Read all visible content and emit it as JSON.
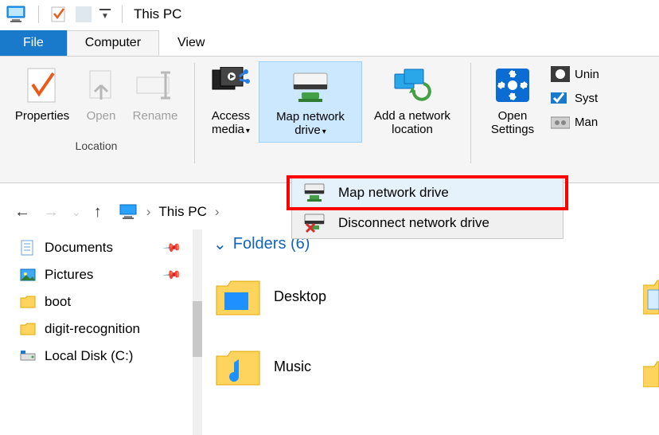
{
  "title": "This PC",
  "tabs": [
    "File",
    "Computer",
    "View"
  ],
  "ribbon": {
    "location": {
      "group_label": "Location",
      "properties": "Properties",
      "open": "Open",
      "rename": "Rename"
    },
    "network": {
      "access_media_l1": "Access",
      "access_media_l2": "media",
      "map_drive_l1": "Map network",
      "map_drive_l2": "drive",
      "add_loc_l1": "Add a network",
      "add_loc_l2": "location"
    },
    "system": {
      "open_settings_l1": "Open",
      "open_settings_l2": "Settings",
      "items": [
        "Unin",
        "Syst",
        "Man"
      ]
    }
  },
  "dropdown": {
    "items": [
      "Map network drive",
      "Disconnect network drive"
    ]
  },
  "breadcrumb": [
    "This PC"
  ],
  "sidebar": [
    {
      "label": "Documents",
      "pinned": true
    },
    {
      "label": "Pictures",
      "pinned": true
    },
    {
      "label": "boot",
      "pinned": false
    },
    {
      "label": "digit-recognition",
      "pinned": false
    },
    {
      "label": "Local Disk (C:)",
      "pinned": false
    }
  ],
  "main": {
    "folders_header": "Folders (6)",
    "folders": [
      "Desktop",
      "Music"
    ]
  }
}
